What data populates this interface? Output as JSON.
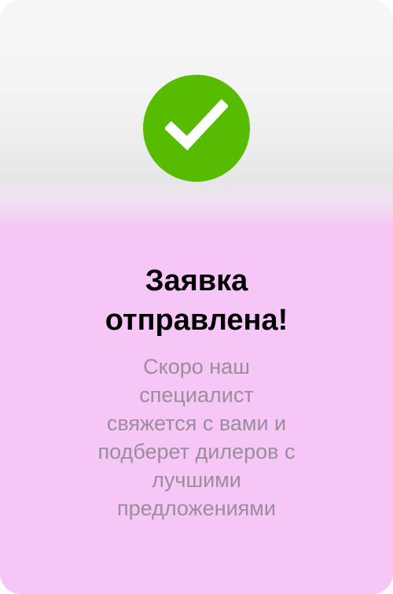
{
  "dialog": {
    "icon": "checkmark-circle-icon",
    "title_line1": "Заявка",
    "title_line2": "отправлена!",
    "message_lines": [
      "Скоро наш",
      "специалист",
      "свяжется с вами и",
      "подберет дилеров с",
      "лучшими",
      "предложениями"
    ]
  },
  "colors": {
    "success": "#57bb00",
    "background_top": "#f6f6f6",
    "background_bottom": "#f6c6f7",
    "title": "#000000",
    "message": "#9a8e9b"
  }
}
